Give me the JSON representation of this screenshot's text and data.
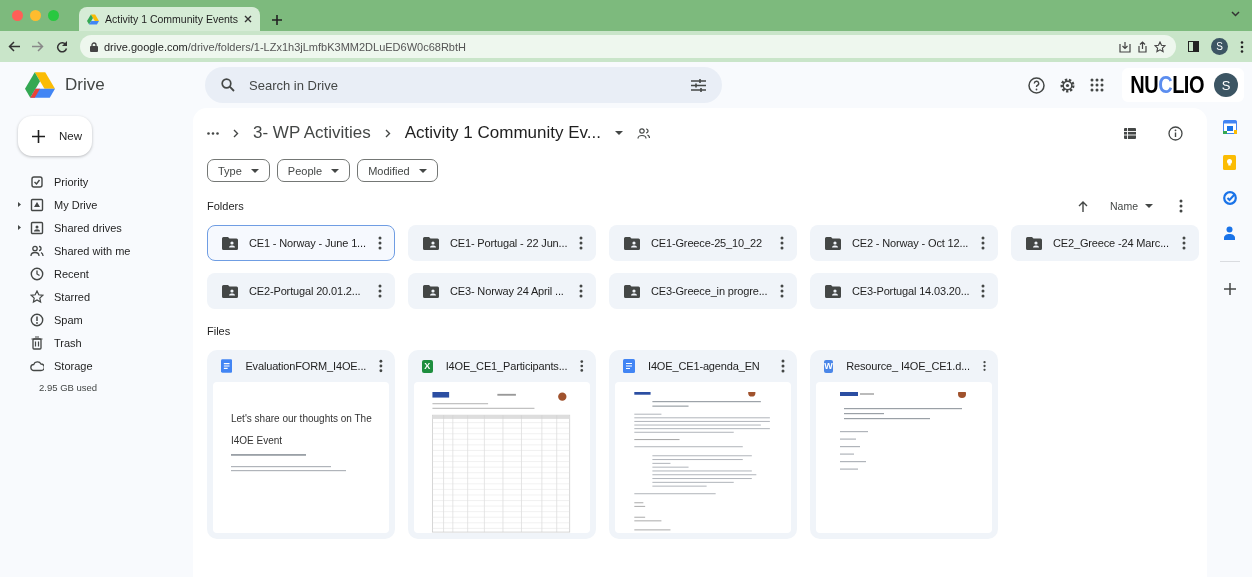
{
  "browser": {
    "tab_title": "Activity 1 Community Events",
    "url_host": "drive.google.com",
    "url_path": "/drive/folders/1-LZx1h3jLmfbK3MM2DLuED6W0c68RbtH",
    "profile_initial": "S"
  },
  "header": {
    "app_name": "Drive",
    "search_placeholder": "Search in Drive",
    "org_logo": "NUCLIO",
    "account_initial": "S"
  },
  "sidebar": {
    "new_button": "New",
    "items": [
      {
        "label": "Priority",
        "expandable": false
      },
      {
        "label": "My Drive",
        "expandable": true
      },
      {
        "label": "Shared drives",
        "expandable": true
      },
      {
        "label": "Shared with me",
        "expandable": false
      },
      {
        "label": "Recent",
        "expandable": false
      },
      {
        "label": "Starred",
        "expandable": false
      },
      {
        "label": "Spam",
        "expandable": false
      },
      {
        "label": "Trash",
        "expandable": false
      },
      {
        "label": "Storage",
        "expandable": false
      }
    ],
    "storage_used": "2.95 GB used"
  },
  "breadcrumb": [
    "3- WP Activities",
    "Activity 1 Community Ev..."
  ],
  "filters": [
    "Type",
    "People",
    "Modified"
  ],
  "folders": {
    "heading": "Folders",
    "sort": "Name",
    "items": [
      {
        "name": "CE1 - Norway - June 1...",
        "selected": true
      },
      {
        "name": "CE1- Portugal - 22 Jun...",
        "selected": false
      },
      {
        "name": "CE1-Greece-25_10_22",
        "selected": false
      },
      {
        "name": "CE2 - Norway - Oct 12...",
        "selected": false
      },
      {
        "name": "CE2_Greece -24 Marc...",
        "selected": false
      },
      {
        "name": "CE2-Portugal 20.01.2...",
        "selected": false
      },
      {
        "name": "CE3- Norway 24 April ...",
        "selected": false
      },
      {
        "name": "CE3-Greece_in progre...",
        "selected": false
      },
      {
        "name": "CE3-Portugal 14.03.20...",
        "selected": false
      }
    ]
  },
  "files": {
    "heading": "Files",
    "items": [
      {
        "name": "EvaluationFORM_I4OE...",
        "kind": "doc",
        "preview": {
          "kind": "form",
          "lines": [
            "Let's share our thoughts on The",
            "I4OE Event"
          ]
        }
      },
      {
        "name": "I4OE_CE1_Participants...",
        "kind": "sheet",
        "badge": "X",
        "preview": {
          "kind": "table"
        }
      },
      {
        "name": "I4OE_CE1-agenda_EN",
        "kind": "doc",
        "preview": {
          "kind": "agenda"
        }
      },
      {
        "name": "Resource_ I4OE_CE1.d...",
        "kind": "word",
        "badge": "W",
        "preview": {
          "kind": "resource"
        }
      }
    ]
  }
}
